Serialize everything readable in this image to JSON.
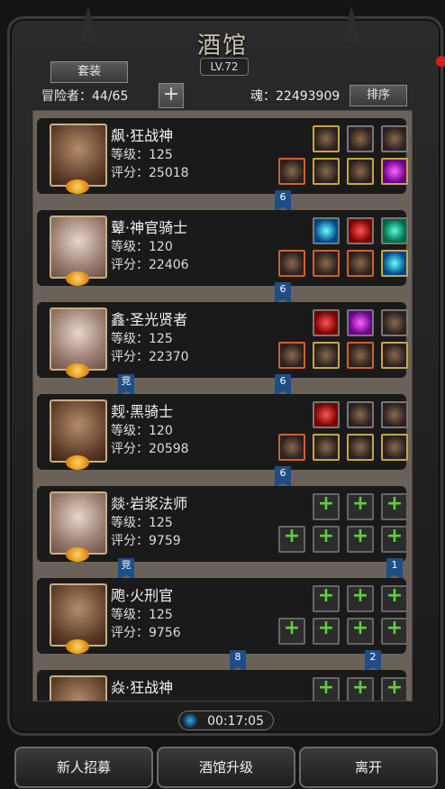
{
  "header": {
    "title": "酒馆",
    "level": "LV.72",
    "set_button": "套装",
    "adventurers_label": "冒险者：44/65",
    "soul_label": "魂：22493909",
    "sort_button": "排序"
  },
  "heroes": [
    {
      "name": "飙·狂战神",
      "level": "等级：125",
      "score": "评分：25018",
      "gender": "male"
    },
    {
      "name": "鼙·神官骑士",
      "level": "等级：120",
      "score": "评分：22406",
      "gender": "female"
    },
    {
      "name": "鑫·圣光贤者",
      "level": "等级：125",
      "score": "评分：22370",
      "gender": "female"
    },
    {
      "name": "觌·黑骑士",
      "level": "等级：120",
      "score": "评分：20598",
      "gender": "male"
    },
    {
      "name": "燚·岩浆法师",
      "level": "等级：125",
      "score": "评分：9759",
      "gender": "female"
    },
    {
      "name": "飑·火刑官",
      "level": "等级：125",
      "score": "评分：9756",
      "gender": "male"
    },
    {
      "name": "焱·狂战神",
      "level": "",
      "score": "",
      "gender": "male"
    }
  ],
  "flags": {
    "f1": "6",
    "f2": "6",
    "f3a": "竞",
    "f3b": "6",
    "f4": "6",
    "f5a": "竞",
    "f5b": "1",
    "f6a": "8",
    "f6b": "2"
  },
  "timer": "00:17:05",
  "footer": {
    "recruit": "新人招募",
    "upgrade": "酒馆升级",
    "leave": "离开"
  }
}
